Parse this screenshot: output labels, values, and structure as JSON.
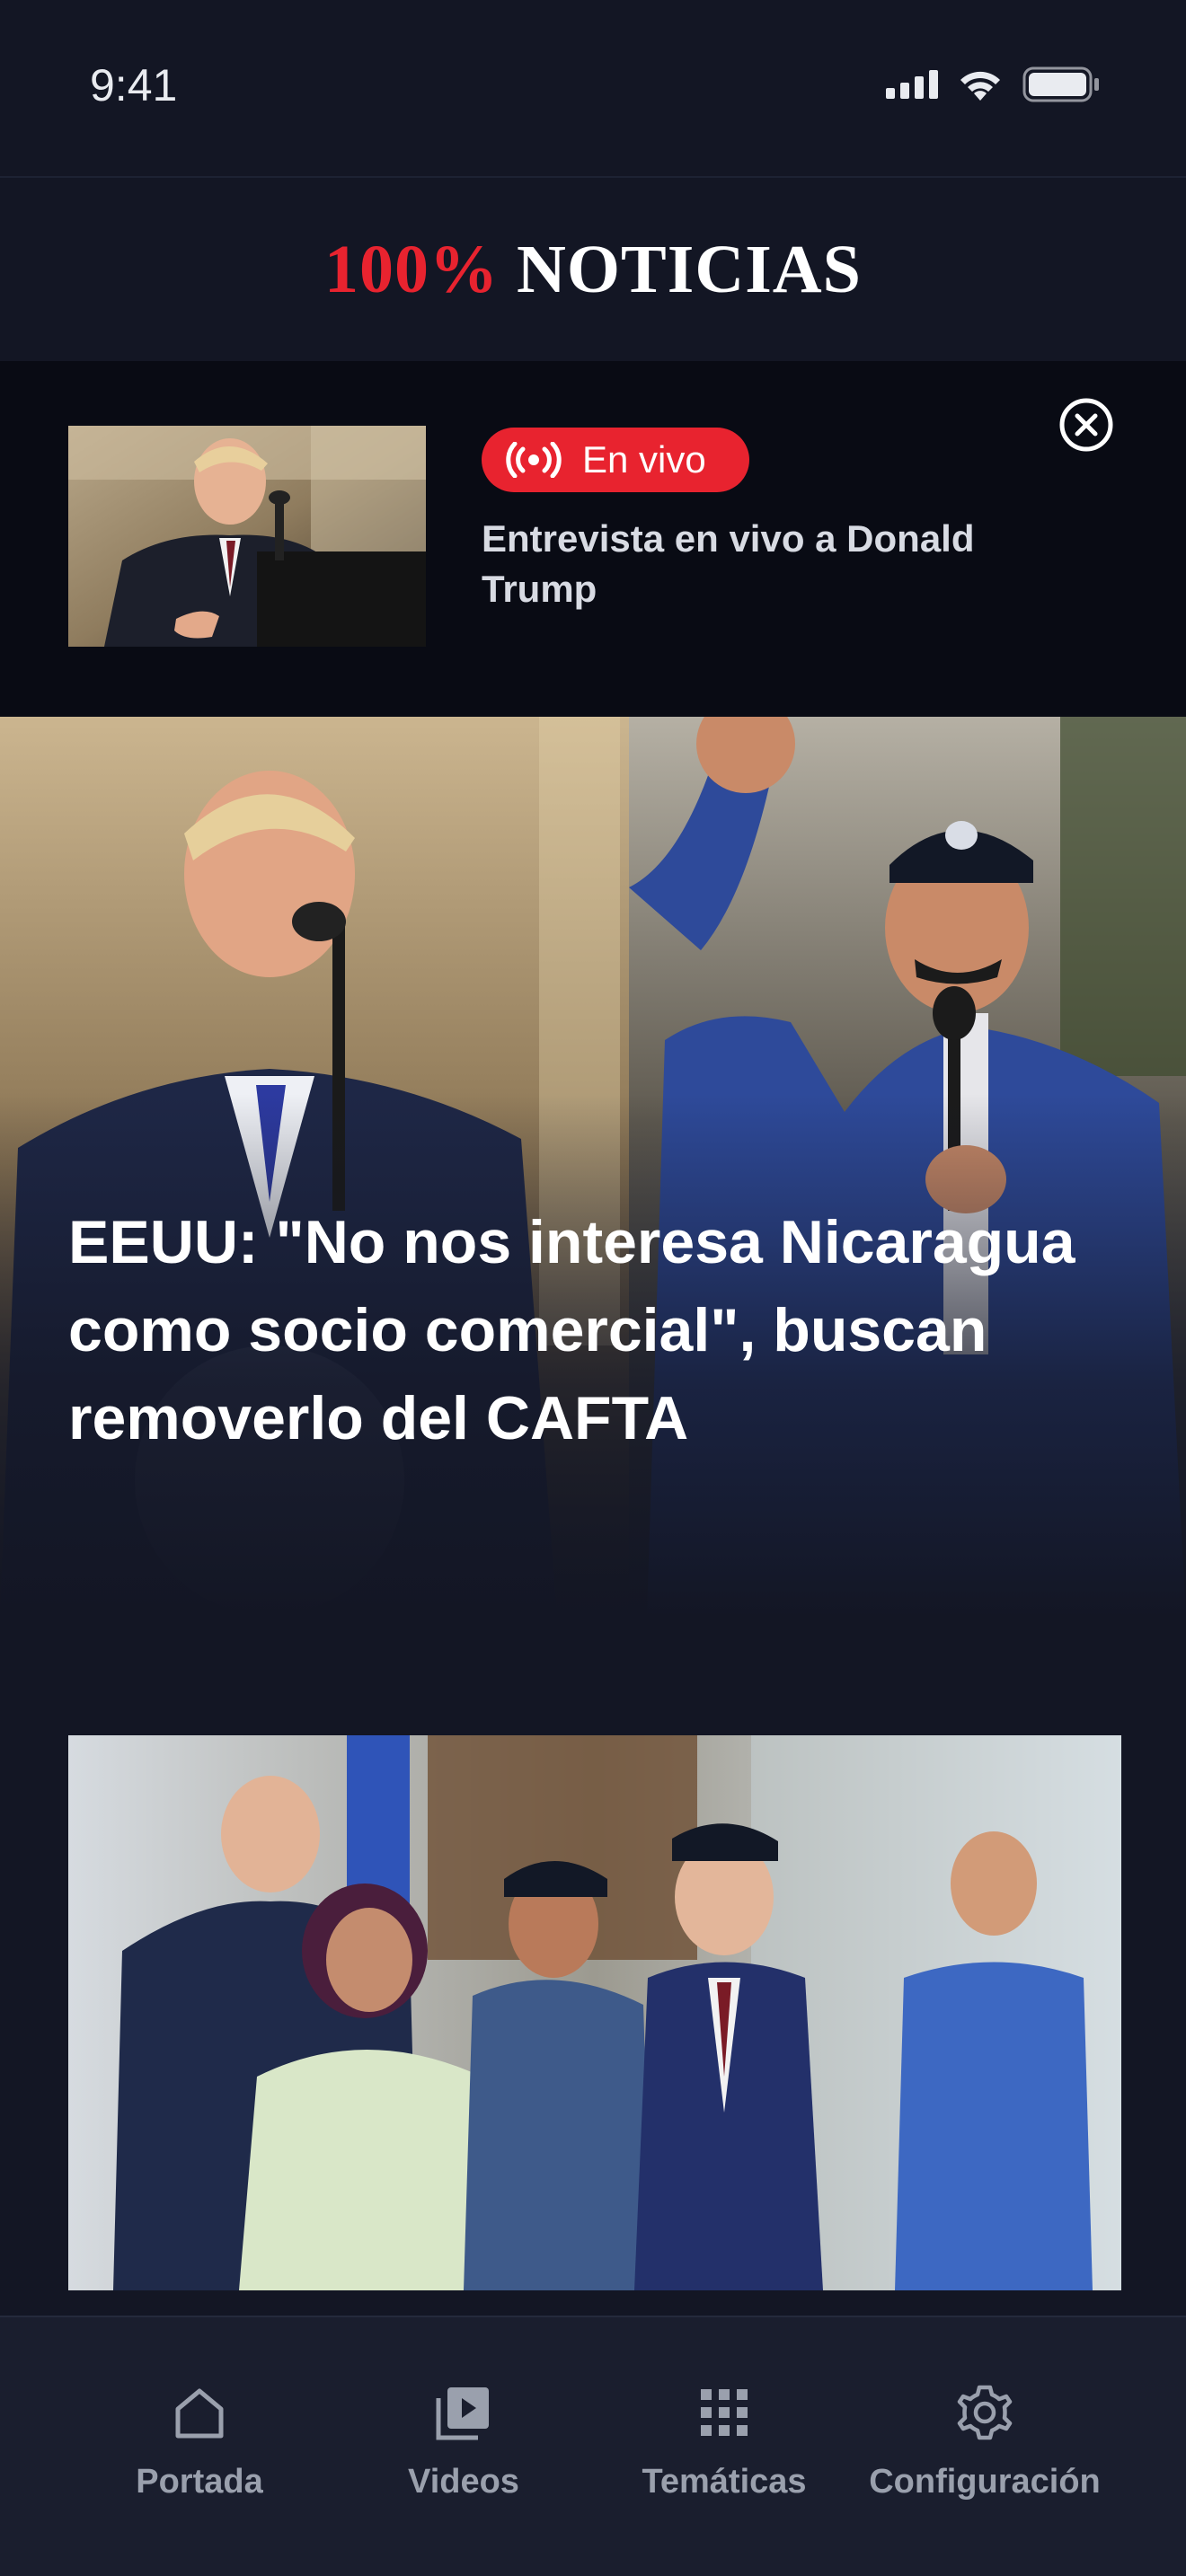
{
  "status_bar": {
    "time": "9:41"
  },
  "header": {
    "logo_percent": "100%",
    "logo_name": "NOTICIAS"
  },
  "live_banner": {
    "badge_label": "En vivo",
    "title": "Entrevista en vivo a Donald Trump"
  },
  "hero": {
    "title": "EEUU: \"No nos interesa Nicaragua como socio comercial\", buscan removerlo del CAFTA"
  },
  "tab_bar": {
    "items": [
      {
        "label": "Portada",
        "icon": "home-icon"
      },
      {
        "label": "Videos",
        "icon": "video-library-icon"
      },
      {
        "label": "Temáticas",
        "icon": "grid-icon"
      },
      {
        "label": "Configuración",
        "icon": "gear-icon"
      }
    ]
  },
  "colors": {
    "background": "#131624",
    "banner_background": "#090b14",
    "accent_red": "#e8232f",
    "tab_bar_background": "#1a1e2e",
    "tab_label": "#9aa0ad"
  }
}
